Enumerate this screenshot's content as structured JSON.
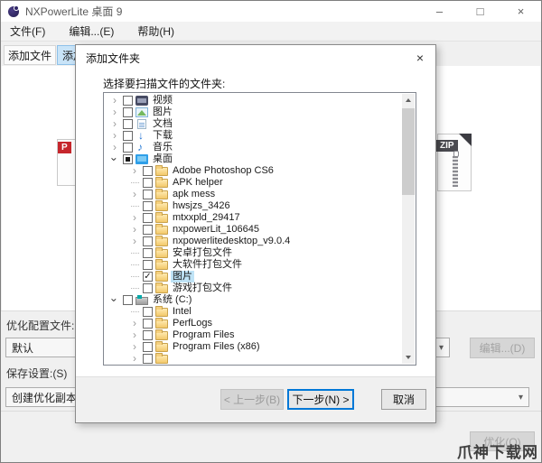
{
  "window": {
    "title": "NXPowerLite 桌面 9",
    "controls": {
      "minimize": "–",
      "maximize": "□",
      "close": "×"
    }
  },
  "menu": {
    "items": [
      {
        "label": "文件(F)"
      },
      {
        "label": "编辑...(E)"
      },
      {
        "label": "帮助(H)"
      }
    ]
  },
  "toolbar": {
    "tabs": [
      {
        "label": "添加文件"
      },
      {
        "label": "添加文件夹"
      }
    ]
  },
  "main": {
    "file_icons": [
      {
        "type": "pdf-file",
        "badge": "P"
      },
      {
        "type": "zip-file",
        "badge": "ZIP"
      }
    ],
    "profile_label": "优化配置文件:(P)",
    "profile_value": "默认",
    "edit_button": "编辑...(D)",
    "save_label": "保存设置:(S)",
    "save_value": "创建优化副本",
    "optimize_button": "优化(O)",
    "watermark": "爪神下载网"
  },
  "dialog": {
    "title": "添加文件夹",
    "close": "×",
    "prompt": "选择要扫描文件的文件夹:",
    "tree": [
      {
        "label": "视频",
        "level": 0,
        "expand": "collapsed",
        "check": "unchecked",
        "icon": "videos-icon"
      },
      {
        "label": "图片",
        "level": 0,
        "expand": "collapsed",
        "check": "unchecked",
        "icon": "pictures-icon"
      },
      {
        "label": "文档",
        "level": 0,
        "expand": "collapsed",
        "check": "unchecked",
        "icon": "documents-icon"
      },
      {
        "label": "下载",
        "level": 0,
        "expand": "collapsed",
        "check": "unchecked",
        "icon": "downloads-icon"
      },
      {
        "label": "音乐",
        "level": 0,
        "expand": "collapsed",
        "check": "unchecked",
        "icon": "music-icon"
      },
      {
        "label": "桌面",
        "level": 0,
        "expand": "expanded",
        "check": "indeterminate",
        "icon": "desktop-icon"
      },
      {
        "label": "Adobe Photoshop CS6",
        "level": 1,
        "expand": "collapsed",
        "check": "unchecked",
        "icon": "folder-icon"
      },
      {
        "label": "APK helper",
        "level": 1,
        "expand": "none",
        "check": "unchecked",
        "icon": "folder-icon"
      },
      {
        "label": "apk mess",
        "level": 1,
        "expand": "collapsed",
        "check": "unchecked",
        "icon": "folder-icon"
      },
      {
        "label": "hwsjzs_3426",
        "level": 1,
        "expand": "none",
        "check": "unchecked",
        "icon": "folder-icon"
      },
      {
        "label": "mtxxpld_29417",
        "level": 1,
        "expand": "collapsed",
        "check": "unchecked",
        "icon": "folder-icon"
      },
      {
        "label": "nxpowerLit_106645",
        "level": 1,
        "expand": "collapsed",
        "check": "unchecked",
        "icon": "folder-icon"
      },
      {
        "label": "nxpowerlitedesktop_v9.0.4",
        "level": 1,
        "expand": "collapsed",
        "check": "unchecked",
        "icon": "folder-icon"
      },
      {
        "label": "安卓打包文件",
        "level": 1,
        "expand": "none",
        "check": "unchecked",
        "icon": "folder-icon"
      },
      {
        "label": "大软件打包文件",
        "level": 1,
        "expand": "none",
        "check": "unchecked",
        "icon": "folder-icon"
      },
      {
        "label": "图片",
        "level": 1,
        "expand": "none",
        "check": "checked",
        "icon": "folder-icon",
        "selected": true
      },
      {
        "label": "游戏打包文件",
        "level": 1,
        "expand": "none",
        "check": "unchecked",
        "icon": "folder-icon"
      },
      {
        "label": "系统 (C:)",
        "level": 0,
        "expand": "expanded",
        "check": "unchecked",
        "icon": "drive-icon"
      },
      {
        "label": "Intel",
        "level": 1,
        "expand": "none",
        "check": "unchecked",
        "icon": "folder-icon"
      },
      {
        "label": "PerfLogs",
        "level": 1,
        "expand": "collapsed",
        "check": "unchecked",
        "icon": "folder-icon"
      },
      {
        "label": "Program Files",
        "level": 1,
        "expand": "collapsed",
        "check": "unchecked",
        "icon": "folder-icon"
      },
      {
        "label": "Program Files (x86)",
        "level": 1,
        "expand": "collapsed",
        "check": "unchecked",
        "icon": "folder-icon"
      },
      {
        "label": "",
        "level": 1,
        "expand": "collapsed",
        "check": "unchecked",
        "icon": "folder-icon"
      }
    ],
    "buttons": {
      "back": "< 上一步(B)",
      "next": "下一步(N) >",
      "cancel": "取消"
    }
  },
  "colors": {
    "accent": "#0078d7",
    "tab_highlight": "#c9e4f8",
    "tree_selection": "#bfe3f6",
    "folder": "#f3c96b",
    "pdf_badge": "#c6262c",
    "zip_badge": "#4a4a50",
    "window_bg": "#f0f0f0"
  }
}
